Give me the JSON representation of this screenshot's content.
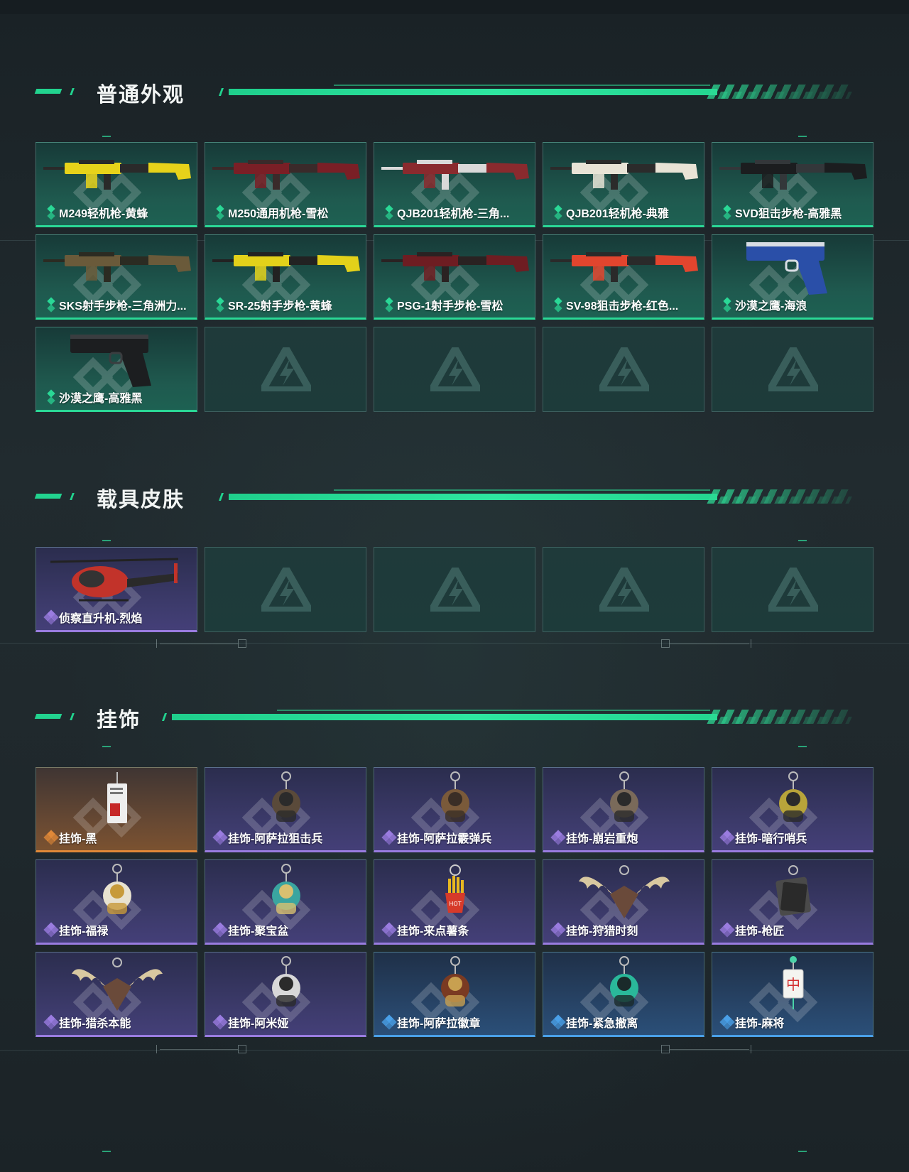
{
  "sections": [
    {
      "title": "普通外观",
      "items": [
        {
          "name": "M249轻机枪-黄蜂",
          "rarity": "green",
          "icon": "rifle-icon",
          "colors": [
            "#e7d21a",
            "#2a2a2a"
          ]
        },
        {
          "name": "M250通用机枪-雪松",
          "rarity": "green",
          "icon": "rifle-icon",
          "colors": [
            "#7a1f26",
            "#3a2a2a"
          ]
        },
        {
          "name": "QJB201轻机枪-三角...",
          "rarity": "green",
          "icon": "rifle-icon",
          "colors": [
            "#8a2a2e",
            "#d9d9d9"
          ]
        },
        {
          "name": "QJB201轻机枪-典雅",
          "rarity": "green",
          "icon": "rifle-icon",
          "colors": [
            "#e8e3d6",
            "#2b2b2b"
          ]
        },
        {
          "name": "SVD狙击步枪-高雅黑",
          "rarity": "green",
          "icon": "rifle-icon",
          "colors": [
            "#1b1d1f",
            "#33373a"
          ]
        },
        {
          "name": "SKS射手步枪-三角洲力...",
          "rarity": "green",
          "icon": "rifle-icon",
          "colors": [
            "#6a5a3a",
            "#2b2b22"
          ]
        },
        {
          "name": "SR-25射手步枪-黄蜂",
          "rarity": "green",
          "icon": "rifle-icon",
          "colors": [
            "#e3d11a",
            "#222"
          ]
        },
        {
          "name": "PSG-1射手步枪-雪松",
          "rarity": "green",
          "icon": "rifle-icon",
          "colors": [
            "#6e1d22",
            "#2a2222"
          ]
        },
        {
          "name": "SV-98狙击步枪-红色...",
          "rarity": "green",
          "icon": "rifle-icon",
          "colors": [
            "#e2452e",
            "#2a2a2a"
          ]
        },
        {
          "name": "沙漠之鹰-海浪",
          "rarity": "green",
          "icon": "pistol-icon",
          "colors": [
            "#2a4fa8",
            "#d8dde4"
          ]
        },
        {
          "name": "沙漠之鹰-高雅黑",
          "rarity": "green",
          "icon": "pistol-icon",
          "colors": [
            "#1c1e20",
            "#3a3d40"
          ]
        },
        {
          "name": "",
          "rarity": "empty"
        },
        {
          "name": "",
          "rarity": "empty"
        },
        {
          "name": "",
          "rarity": "empty"
        },
        {
          "name": "",
          "rarity": "empty"
        }
      ]
    },
    {
      "title": "载具皮肤",
      "items": [
        {
          "name": "侦察直升机-烈焰",
          "rarity": "purple",
          "icon": "helicopter-icon",
          "colors": [
            "#c2332a",
            "#2a2a2a"
          ]
        },
        {
          "name": "",
          "rarity": "empty"
        },
        {
          "name": "",
          "rarity": "empty"
        },
        {
          "name": "",
          "rarity": "empty"
        },
        {
          "name": "",
          "rarity": "empty"
        }
      ]
    },
    {
      "title": "挂饰",
      "items": [
        {
          "name": "挂饰-黑",
          "rarity": "orange",
          "icon": "tag-charm-icon",
          "colors": [
            "#eeeeee",
            "#c62828"
          ]
        },
        {
          "name": "挂饰-阿萨拉狙击兵",
          "rarity": "purple",
          "icon": "soldier-charm-icon",
          "colors": [
            "#5a4a3a",
            "#2b2b2b"
          ]
        },
        {
          "name": "挂饰-阿萨拉霰弹兵",
          "rarity": "purple",
          "icon": "soldier-charm-icon",
          "colors": [
            "#7a5a3a",
            "#3a2e26"
          ]
        },
        {
          "name": "挂饰-崩岩重炮",
          "rarity": "purple",
          "icon": "soldier-charm-icon",
          "colors": [
            "#7a6a5a",
            "#2b2b2b"
          ]
        },
        {
          "name": "挂饰-暗行哨兵",
          "rarity": "purple",
          "icon": "soldier-charm-icon",
          "colors": [
            "#b8a43a",
            "#2b2b2b"
          ]
        },
        {
          "name": "挂饰-福禄",
          "rarity": "purple",
          "icon": "gourd-charm-icon",
          "colors": [
            "#e8e2d0",
            "#c79a3a"
          ]
        },
        {
          "name": "挂饰-聚宝盆",
          "rarity": "purple",
          "icon": "treasure-charm-icon",
          "colors": [
            "#3aa5a0",
            "#d8c070"
          ]
        },
        {
          "name": "挂饰-来点薯条",
          "rarity": "purple",
          "icon": "fries-charm-icon",
          "colors": [
            "#e8b820",
            "#d63a2a"
          ]
        },
        {
          "name": "挂饰-狩猎时刻",
          "rarity": "purple",
          "icon": "antler-charm-icon",
          "colors": [
            "#d8c8a0",
            "#6a4a3a"
          ]
        },
        {
          "name": "挂饰-枪匠",
          "rarity": "purple",
          "icon": "dogtag-charm-icon",
          "colors": [
            "#4a4a4a",
            "#2a2a2a"
          ]
        },
        {
          "name": "挂饰-猎杀本能",
          "rarity": "purple",
          "icon": "antler-charm-icon",
          "colors": [
            "#d8c8a0",
            "#6a4a3a"
          ]
        },
        {
          "name": "挂饰-阿米娅",
          "rarity": "purple",
          "icon": "rabbit-charm-icon",
          "colors": [
            "#d8d8d8",
            "#2b2b2b"
          ]
        },
        {
          "name": "挂饰-阿萨拉徽章",
          "rarity": "blue",
          "icon": "badge-charm-icon",
          "colors": [
            "#7a3a22",
            "#c8a050"
          ]
        },
        {
          "name": "挂饰-紧急撤离",
          "rarity": "blue",
          "icon": "device-charm-icon",
          "colors": [
            "#2ab89a",
            "#1a2a2a"
          ]
        },
        {
          "name": "挂饰-麻将",
          "rarity": "blue",
          "icon": "mahjong-charm-icon",
          "colors": [
            "#f4f4f0",
            "#d32f2f"
          ]
        }
      ]
    }
  ],
  "rarity_colors": {
    "green": "#2ad896",
    "purple": "#9a7ce0",
    "blue": "#4aa0e8",
    "orange": "#e08838"
  },
  "mahjong_glyph": "中",
  "fries_label": "HOT"
}
